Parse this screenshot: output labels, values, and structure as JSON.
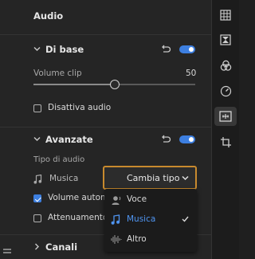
{
  "panel": {
    "title": "Audio"
  },
  "basic": {
    "title": "Di base",
    "volume_label": "Volume clip",
    "volume_value": "50",
    "volume_level": 0.5,
    "mute_label": "Disattiva audio",
    "mute_checked": false,
    "enabled": true
  },
  "advanced": {
    "title": "Avanzate",
    "enabled": true,
    "audio_type_label": "Tipo di audio",
    "audio_type_value": "Musica",
    "change_type_button": "Cambia tipo",
    "auto_volume_label": "Volume automat",
    "auto_volume_checked": true,
    "ducking_label": "Attenuamento au",
    "ducking_checked": false
  },
  "channels": {
    "title": "Canali"
  },
  "dropdown": {
    "items": [
      {
        "label": "Voce",
        "icon": "voice-icon",
        "selected": false
      },
      {
        "label": "Musica",
        "icon": "music-note-icon",
        "selected": true
      },
      {
        "label": "Altro",
        "icon": "waveform-icon",
        "selected": false
      }
    ]
  },
  "right_rail": {
    "icons": [
      "grid-icon",
      "hourglass-icon",
      "color-circles-icon",
      "speedometer-icon",
      "audio-icon",
      "crop-icon"
    ],
    "active": "audio-icon"
  },
  "colors": {
    "accent": "#3d7fe0",
    "focus_outline": "#c88a2e",
    "selected_text": "#4f94f0"
  }
}
